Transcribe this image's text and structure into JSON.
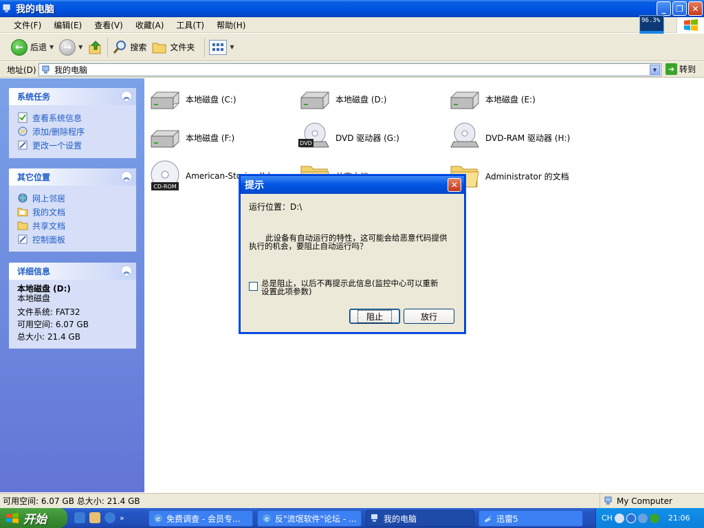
{
  "window": {
    "title": "我的电脑"
  },
  "menu": [
    "文件(F)",
    "编辑(E)",
    "查看(V)",
    "收藏(A)",
    "工具(T)",
    "帮助(H)"
  ],
  "net_meter": "96.3%",
  "toolbar": {
    "back_label": "后退",
    "search_label": "搜索",
    "folders_label": "文件夹"
  },
  "address": {
    "label": "地址(D)",
    "value": "我的电脑",
    "go_label": "转到"
  },
  "left_panels": {
    "system_tasks": {
      "title": "系统任务",
      "items": [
        "查看系统信息",
        "添加/删除程序",
        "更改一个设置"
      ]
    },
    "other_places": {
      "title": "其它位置",
      "items": [
        "网上邻居",
        "我的文档",
        "共享文档",
        "控制面板"
      ]
    },
    "details": {
      "title": "详细信息",
      "name": "本地磁盘 (D:)",
      "type": "本地磁盘",
      "fs": "文件系统: FAT32",
      "free": "可用空间: 6.07 GB",
      "total": "总大小: 21.4 GB"
    }
  },
  "drives": [
    {
      "label": "本地磁盘 (C:)",
      "icon": "hard-disk-icon"
    },
    {
      "label": "本地磁盘 (D:)",
      "icon": "hard-disk-icon"
    },
    {
      "label": "本地磁盘 (E:)",
      "icon": "hard-disk-icon"
    },
    {
      "label": "本地磁盘 (F:)",
      "icon": "hard-disk-icon"
    },
    {
      "label": "DVD 驱动器 (G:)",
      "icon": "dvd-drive-icon",
      "badge": "DVD"
    },
    {
      "label": "DVD-RAM 驱动器 (H:)",
      "icon": "dvd-ram-drive-icon"
    },
    {
      "label": "American-Stories (I:)",
      "icon": "cd-rom-icon",
      "badge": "CD-ROM"
    },
    {
      "label": "共享文档",
      "icon": "folder-icon"
    },
    {
      "label": "Administrator 的文档",
      "icon": "folder-icon"
    }
  ],
  "dialog": {
    "title": "提示",
    "location": "运行位置：D:\\",
    "message_line1": "此设备有自动运行的特性，这可能会给恶意代码提供",
    "message_line2": "执行的机会，要阻止自动运行吗？",
    "checkbox_line1": "总是阻止，以后不再提示此信息(监控中心可以重新",
    "checkbox_line2": "设置此项参数)",
    "block_label": "阻止",
    "allow_label": "放行"
  },
  "status": {
    "left": "可用空间: 6.07 GB 总大小: 21.4 GB",
    "right": "My Computer"
  },
  "taskbar": {
    "start_label": "开始",
    "tasks": [
      "免费调查 - 会员专...",
      "反\"流氓软件\"论坛 - ...",
      "我的电脑",
      "迅雷5"
    ],
    "tray_lang": "CH",
    "clock": "21:06"
  },
  "colors": {
    "xp_blue": "#0054e3",
    "task_pane_link": "#215dc6",
    "start_green": "#3c8f33"
  }
}
